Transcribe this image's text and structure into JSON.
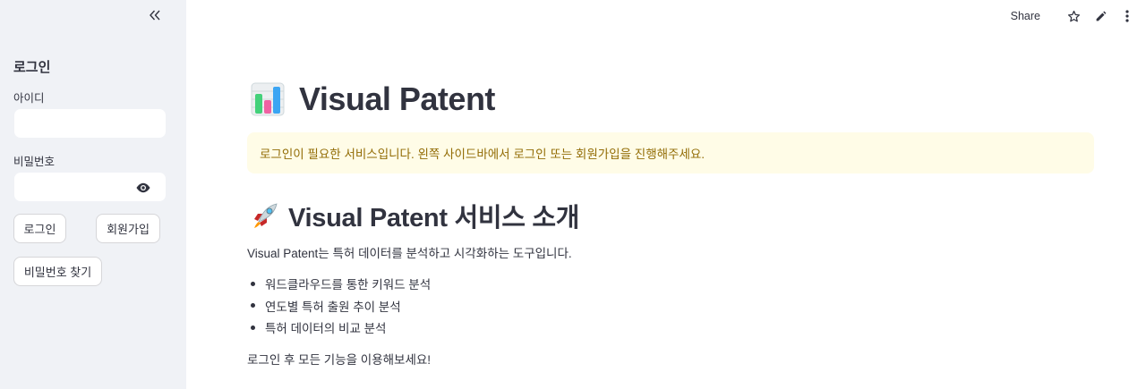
{
  "sidebar": {
    "title": "로그인",
    "id_label": "아이디",
    "id_value": "",
    "password_label": "비밀번호",
    "password_value": "",
    "login_button": "로그인",
    "signup_button": "회원가입",
    "find_password_button": "비밀번호 찾기"
  },
  "toolbar": {
    "share_label": "Share",
    "icons": [
      "star-icon",
      "edit-pencil-icon",
      "more-vertical-icon"
    ]
  },
  "main": {
    "title": "Visual Patent",
    "title_icon": "bar-chart-icon",
    "alert_text": "로그인이 필요한 서비스입니다. 왼쪽 사이드바에서 로그인 또는 회원가입을 진행해주세요.",
    "section_title": "Visual Patent 서비스 소개",
    "section_icon": "rocket-icon",
    "intro": "Visual Patent는 특허 데이터를 분석하고 시각화하는 도구입니다.",
    "features": [
      "워드클라우드를 통한 키워드 분석",
      "연도별 특허 출원 추이 분석",
      "특허 데이터의 비교 분석"
    ],
    "closing": "로그인 후 모든 기능을 이용해보세요!"
  },
  "colors": {
    "sidebar_bg": "#f0f2f6",
    "alert_bg": "#fffce7",
    "alert_text": "#926c05",
    "text": "#31333f"
  }
}
